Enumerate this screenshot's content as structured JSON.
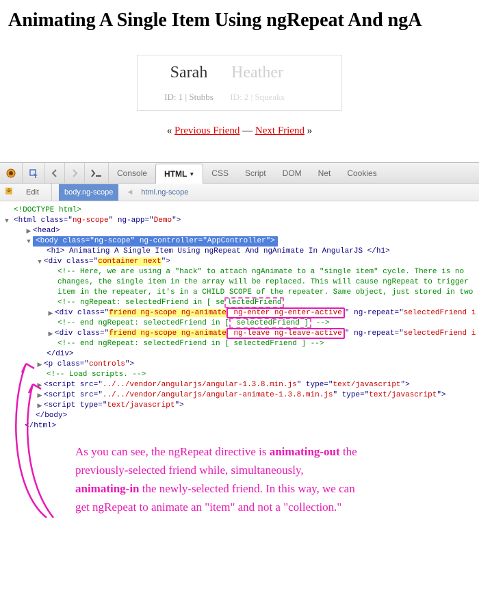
{
  "title": "Animating A Single Item Using ngRepeat And ngA",
  "friend1": {
    "name": "Sarah",
    "sub": "ID: 1  |  Stubbs"
  },
  "friend2": {
    "name": "Heather",
    "sub": "ID: 2  |  Squeaks"
  },
  "controls": {
    "open": "«",
    "prev": "Previous Friend",
    "sep": " — ",
    "next": "Next Friend",
    "close": "»"
  },
  "devtools": {
    "tabs": {
      "console": "Console",
      "html": "HTML",
      "css": "CSS",
      "script": "Script",
      "dom": "DOM",
      "net": "Net",
      "cookies": "Cookies"
    },
    "subbar": {
      "edit": "Edit",
      "crumb1": "body.ng-scope",
      "crumb2": "html.ng-scope"
    },
    "tree": {
      "doctype": "<!DOCTYPE html>",
      "html_open": "<html class=\"ng-scope\" ng-app=\"Demo\">",
      "head": "<head>",
      "body_open": "<body class=\"ng-scope\" ng-controller=\"AppController\">",
      "h1": "<h1> Animating A Single Item Using ngRepeat And ngAnimate In AngularJS </h1>",
      "container_pre": "<div class=\"",
      "container_cls": "container next",
      "container_post": "\">",
      "comment1a": "<!-- Here, we are using a \"hack\" to attach ngAnimate to a \"single item\" cycle. There is no ",
      "comment1b": "changes, the single item in the array will be replaced. This will cause ngRepeat to trigger ",
      "comment1c": "item in the repeater, it's in a CHILD SCOPE of the repeater. Same object, just stored in two",
      "ngrepeat_start": "<!-- ngRepeat: selectedFriend in [ selectedFriend",
      "enter_pre": "<div class=\"",
      "enter_cls1": "friend ng-scope ng-animate",
      "enter_cls2": "ng-enter ng-enter-active",
      "enter_post": "\" ng-repeat=\"selectedFriend i",
      "ngrepeat_end1": "<!-- end ngRepeat: selectedFriend in [ selectedFriend ] -->",
      "leave_pre": "<div class=\"",
      "leave_cls1": "friend ng-scope ng-animate",
      "leave_cls2": "ng-leave ng-leave-active",
      "leave_post": "\" ng-repeat=\"selectedFriend i",
      "ngrepeat_end2": "<!-- end ngRepeat: selectedFriend in [ selectedFriend ] -->",
      "div_close": "</div>",
      "controls_p": "<p class=\"controls\">",
      "load_comment": "<!-- Load scripts. -->",
      "script1": "<script src=\"../../vendor/angularjs/angular-1.3.8.min.js\" type=\"text/javascript\">",
      "script2": "<script src=\"../../vendor/angularjs/angular-animate-1.3.8.min.js\" type=\"text/javascript\">",
      "script3": "<script type=\"text/javascript\">",
      "body_close": "</body>",
      "html_close": "</html>"
    }
  },
  "annotation": {
    "l1": "As you can see, the ngRepeat directive is ",
    "b1": "animating-out",
    "l2": " the",
    "l3": "previously-selected friend while, simultaneously,",
    "b2": "animating-in",
    "l4": " the newly-selected friend. In this way, we can",
    "l5": "get ngRepeat to animate an \"item\" and not a \"collection.\""
  }
}
